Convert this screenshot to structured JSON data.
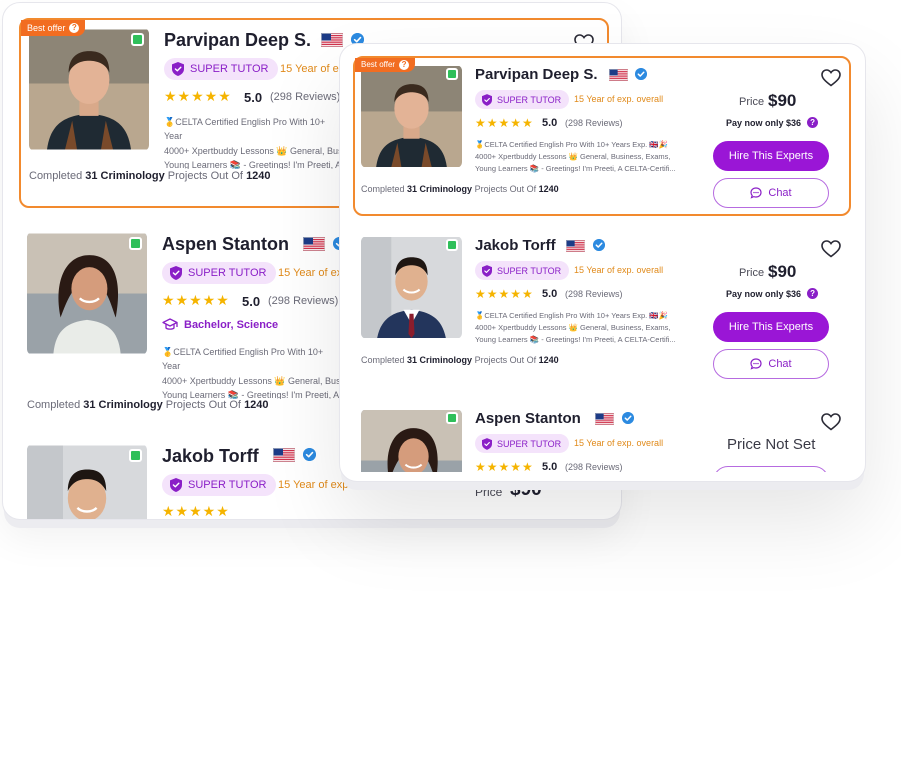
{
  "colors": {
    "accent": "#9a16d6",
    "best_offer": "#f26d21",
    "star": "#f5b400",
    "experience": "#e08a1a",
    "online": "#2fbf5a",
    "verified": "#2c8ae0"
  },
  "common": {
    "best_offer_label": "Best offer",
    "super_tutor_label": "SUPER TUTOR",
    "stars": "★★★★★",
    "rating": "5.0",
    "reviews": "(298 Reviews)",
    "completed_prefix": "Completed",
    "completed_subject": "31 Criminology",
    "completed_mid": "Projects Out Of",
    "completed_total": "1240",
    "price_label": "Price",
    "hire_label": "Hire This Experts",
    "chat_label": "Chat",
    "price_not_set": "Price Not Set"
  },
  "back_panel": {
    "cards": [
      {
        "name": "Parvipan Deep S.",
        "experience": "15 Year of ex",
        "description": "🥇CELTA Certified English Pro With 10+ Year\n4000+ Xpertbuddy Lessons 👑 General, Bus\nYoung Learners 📚 - Greetings! I'm Preeti, A"
      },
      {
        "name": "Aspen Stanton",
        "experience": "15 Year of ex",
        "degree": "Bachelor, Science",
        "description": "🥇CELTA Certified English Pro With 10+ Year\n4000+ Xpertbuddy Lessons 👑 General, Bus\nYoung Learners 📚 - Greetings! I'm Preeti, A"
      },
      {
        "name": "Jakob Torff",
        "experience": "15 Year of exp. overall",
        "price": "$90"
      }
    ]
  },
  "front_panel": {
    "cards": [
      {
        "name": "Parvipan Deep S.",
        "experience": "15 Year of exp. overall",
        "description": "🥇CELTA Certified English Pro With 10+ Years Exp. 🇬🇧🎉\n4000+ Xpertbuddy Lessons 👑 General, Business, Exams,\nYoung Learners 📚 - Greetings! I'm Preeti, A CELTA-Certifi...",
        "price": "$90",
        "pay_now": "Pay now only $36"
      },
      {
        "name": "Jakob Torff",
        "experience": "15 Year of exp. overall",
        "description": "🥇CELTA Certified English Pro With 10+ Years Exp. 🇬🇧🎉\n4000+ Xpertbuddy Lessons 👑 General, Business, Exams,\nYoung Learners 📚 - Greetings! I'm Preeti, A CELTA-Certifi...",
        "price": "$90",
        "pay_now": "Pay now only $36"
      },
      {
        "name": "Aspen Stanton",
        "experience": "15 Year of exp. overall"
      }
    ]
  }
}
